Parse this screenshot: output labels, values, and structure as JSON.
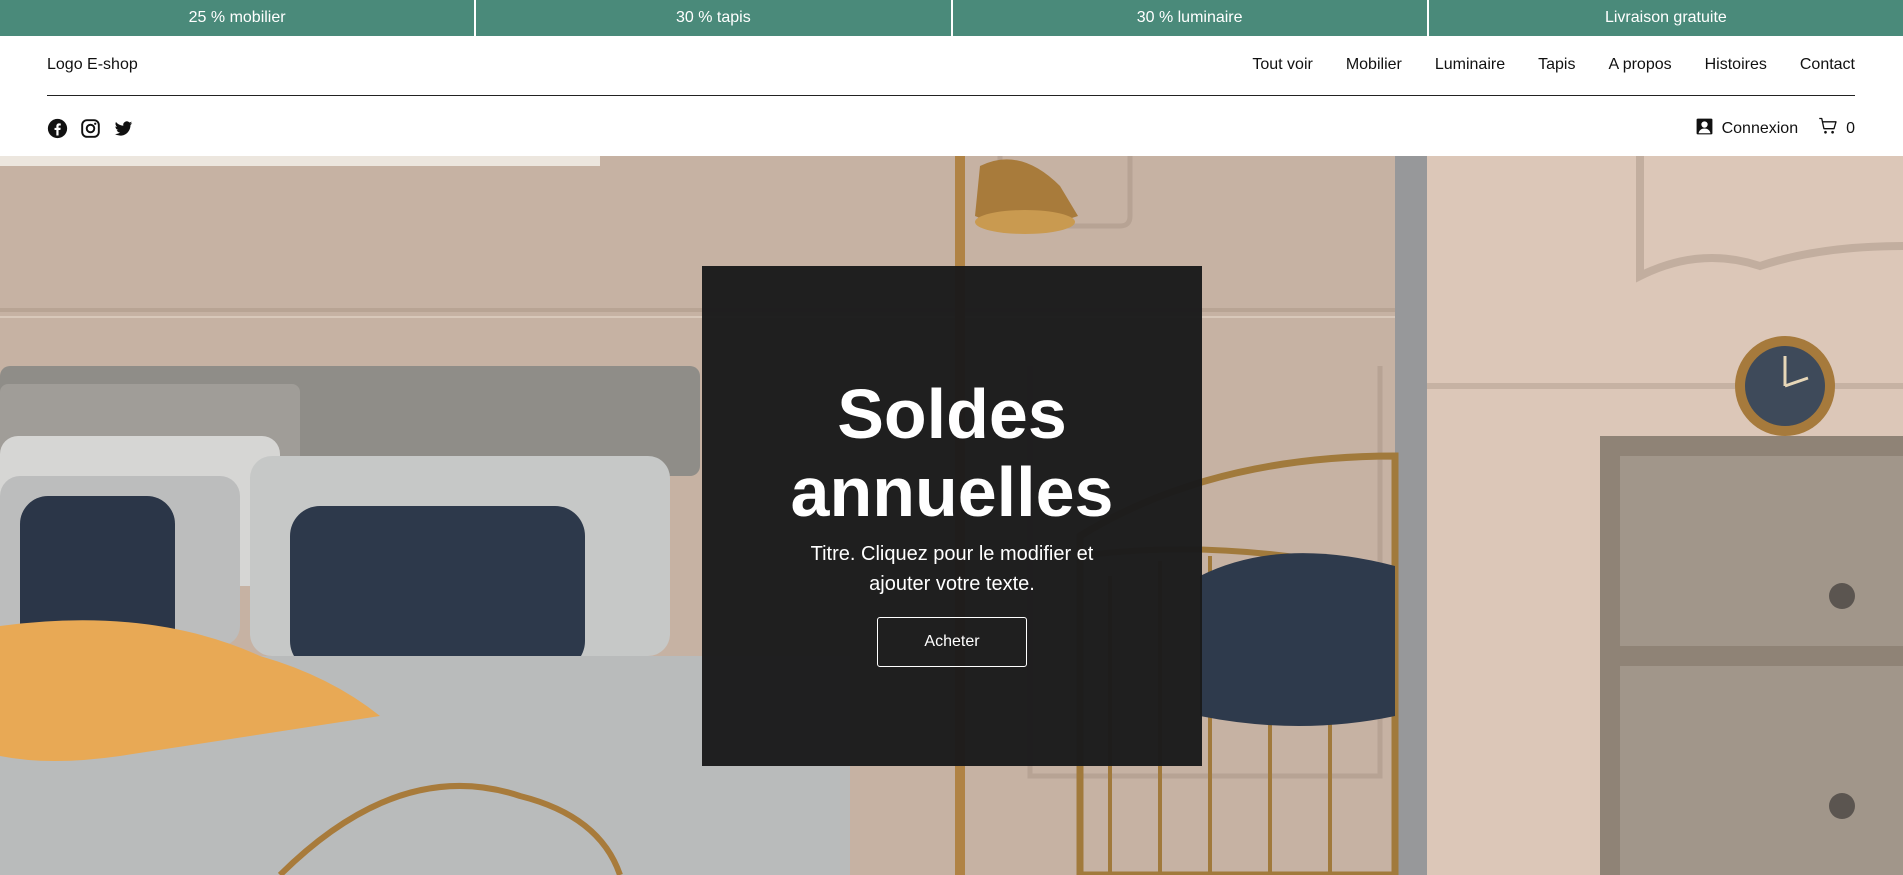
{
  "promo": {
    "items": [
      "25 % mobilier",
      "30 % tapis",
      "30 % luminaire",
      "Livraison gratuite"
    ],
    "color": "#4a8a7a"
  },
  "header": {
    "logo": "Logo E-shop",
    "nav": [
      "Tout voir",
      "Mobilier",
      "Luminaire",
      "Tapis",
      "A propos",
      "Histoires",
      "Contact"
    ],
    "social_icons": [
      "facebook-icon",
      "instagram-icon",
      "twitter-icon"
    ],
    "login_label": "Connexion",
    "cart_count": "0"
  },
  "hero": {
    "title": "Soldes annuelles",
    "subtitle": "Titre. Cliquez pour le modifier et ajouter votre texte.",
    "button_label": "Acheter",
    "box_color": "#1a1a1b"
  }
}
